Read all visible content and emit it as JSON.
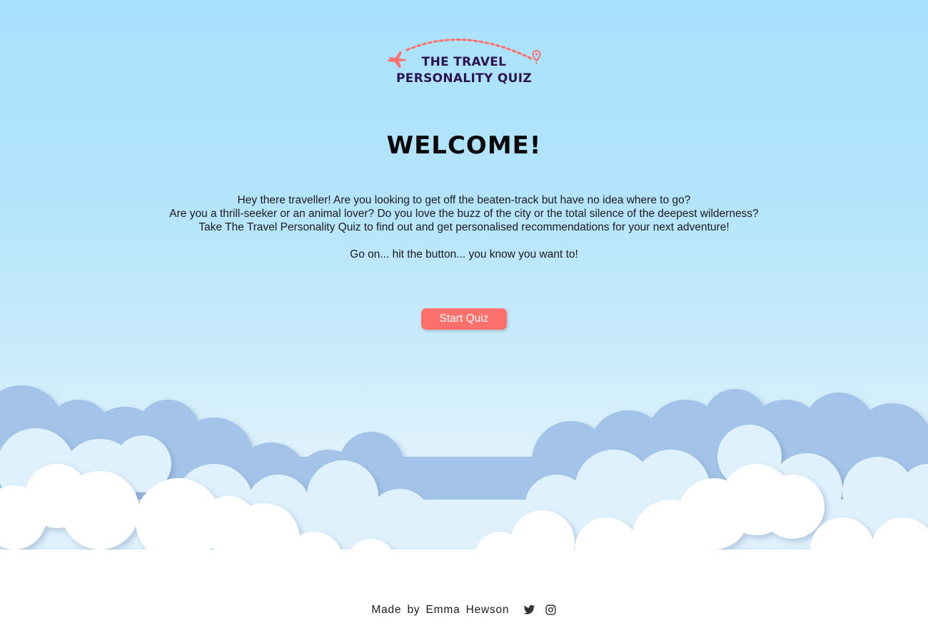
{
  "logo": {
    "title_line1": "THE TRAVEL",
    "title_line2": "PERSONALITY QUIZ",
    "icons": [
      "airplane-icon",
      "map-pin-icon"
    ],
    "accent_color": "#ff6f6b"
  },
  "welcome": {
    "heading": "WELCOME!"
  },
  "intro": {
    "line1": "Hey there traveller! Are you looking to get off the beaten-track but have no idea where to go?",
    "line2": "Are you a thrill-seeker or an animal lover? Do you love the buzz of the city or the total silence of the deepest wilderness?",
    "line3": "Take The Travel Personality Quiz to find out and get personalised recommendations for your next adventure!",
    "line4": "Go on... hit the button... you know you want to!"
  },
  "cta": {
    "label": "Start Quiz",
    "color": "#ff6f6b"
  },
  "footer": {
    "credit": "Made by Emma Hewson",
    "icons": [
      "twitter-icon",
      "instagram-icon"
    ]
  },
  "colors": {
    "sky_top": "#a9e2fd",
    "cloud_back": "#a3c4e8",
    "cloud_mid": "#dff1fd",
    "cloud_front": "#ffffff"
  }
}
